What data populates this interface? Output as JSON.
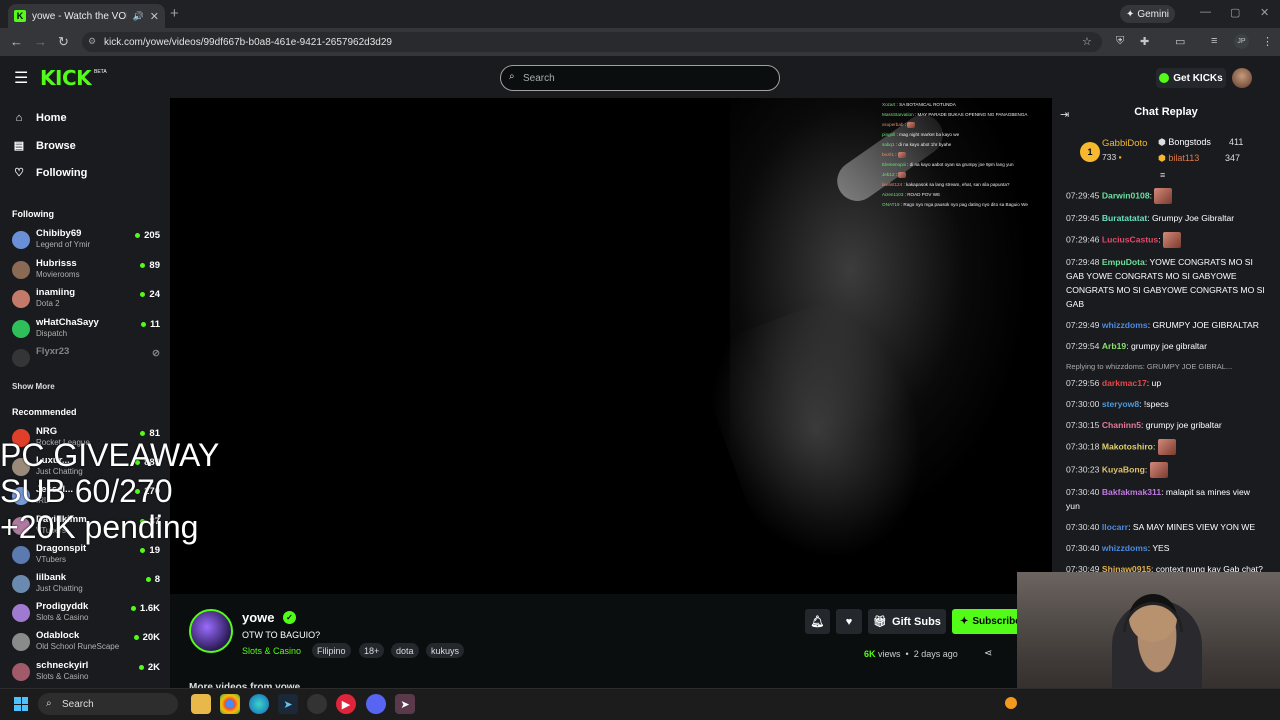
{
  "browser": {
    "tab_title": "yowe - Watch the VOD on Kick",
    "tab_favicon": "K",
    "new_tab": "+",
    "url": "kick.com/yowe/videos/99df667b-b0a8-461e-9421-2657962d3d29",
    "gemini_label": "Gemini",
    "profile_initials": "JP"
  },
  "header": {
    "logo": "KICK",
    "logo_badge": "BETA",
    "search_placeholder": "Search",
    "get_kicks": "Get KICKs"
  },
  "sidebar": {
    "nav": [
      {
        "label": "Home",
        "icon": "home-icon"
      },
      {
        "label": "Browse",
        "icon": "browse-icon"
      },
      {
        "label": "Following",
        "icon": "heart-icon"
      }
    ],
    "following_title": "Following",
    "following": [
      {
        "name": "Chibiby69",
        "category": "Legend of Ymir",
        "count": "205",
        "color": "#6b8fd6"
      },
      {
        "name": "Hubrisss",
        "category": "Movierooms",
        "count": "89",
        "color": "#8a6a55"
      },
      {
        "name": "inamiing",
        "category": "Dota 2",
        "count": "24",
        "color": "#c47a6a"
      },
      {
        "name": "wHatChaSayy",
        "category": "Dispatch",
        "count": "11",
        "color": "#2fbf5a"
      },
      {
        "name": "Flyxr23",
        "category": "",
        "count": "",
        "color": "#555"
      }
    ],
    "show_more": "Show More",
    "recommended_title": "Recommended",
    "recommended": [
      {
        "name": "NRG",
        "category": "Rocket League",
        "count": "81",
        "color": "#e0402a"
      },
      {
        "name": "Luxur...",
        "category": "Just Chatting",
        "count": "889",
        "color": "#9a8a7a"
      },
      {
        "name": "Jessel...",
        "category": "IRL",
        "count": "270",
        "color": "#7a9ad6"
      },
      {
        "name": "Davidkimm_",
        "category": "VTubers",
        "count": "87",
        "color": "#b07aa0"
      },
      {
        "name": "Dragonspit",
        "category": "VTubers",
        "count": "19",
        "color": "#5a7ab0"
      },
      {
        "name": "lilbank",
        "category": "Just Chatting",
        "count": "8",
        "color": "#6a8ab0"
      },
      {
        "name": "Prodigyddk",
        "category": "Slots & Casino",
        "count": "1.6K",
        "color": "#a07ad0"
      },
      {
        "name": "Odablock",
        "category": "Old School RuneScape",
        "count": "20K",
        "color": "#8a8a8a"
      },
      {
        "name": "schneckyirl",
        "category": "Slots & Casino",
        "count": "2K",
        "color": "#a05a6a"
      }
    ]
  },
  "overlay": {
    "line1": "PC GIVEAWAY",
    "line2": "SUB 60/270",
    "line3": "+20K pending"
  },
  "video_chat": [
    {
      "user": "Xozart",
      "text": "SA BOTANICAL ROTUNDA"
    },
    {
      "user": "MassStarvation",
      "text": "MAY PARADE BUKAS OPENING NG PANAGBENGA"
    },
    {
      "user": "xsuperbab",
      "text": ""
    },
    {
      "user": "pingoll",
      "text": "mag night market ba kayo we"
    },
    {
      "user": "sabq1",
      "text": "di na kayo abot 1hr byahe"
    },
    {
      "user": "bezil1",
      "text": ""
    },
    {
      "user": "Elemenopiii",
      "text": "di na kayo aabot oyan sa grumpy joe 9pm lang yun"
    },
    {
      "user": "Jeb12",
      "text": ""
    },
    {
      "user": "lawlist124",
      "text": "kakapasok sa lang stream, ehat, san sila papunta?"
    },
    {
      "user": "Aizen1103",
      "text": "ROAD POV WE"
    },
    {
      "user": "ONAT19",
      "text": "Rago nyo mga pausok nyo pag dating nyo dito sa Baguio We"
    }
  ],
  "stream": {
    "channel": "yowe",
    "title": "OTW TO BAGUIO?",
    "category": "Slots & Casino",
    "tags": [
      "Filipino",
      "18+",
      "dota",
      "kukuys"
    ],
    "gift_subs": "Gift Subs",
    "subscribe": "Subscribe",
    "views_count": "6K",
    "views_label": "views",
    "age": "2 days ago",
    "more_videos": "More videos from yowe"
  },
  "chat": {
    "title": "Chat Replay",
    "leaders": [
      {
        "rank": "1",
        "name": "GabbiDoto",
        "value": "733"
      },
      {
        "name": "Bongstods",
        "value": "411"
      },
      {
        "name": "bilat113",
        "value": "347"
      }
    ],
    "messages": [
      {
        "time": "07:29:45",
        "user": "Darwin0108",
        "text": "",
        "color": "#6ae0a0",
        "emote": true
      },
      {
        "time": "07:29:45",
        "user": "Buratatatat",
        "text": "Grumpy Joe Gibraltar",
        "color": "#6ae0c0"
      },
      {
        "time": "07:29:46",
        "user": "LuciusCastus",
        "text": "",
        "color": "#e04a6a",
        "emote": true
      },
      {
        "time": "07:29:48",
        "user": "EmpuDota",
        "text": "YOWE CONGRATS MO SI GAB YOWE CONGRATS MO SI GABYOWE CONGRATS MO SI GABYOWE CONGRATS MO SI GAB",
        "color": "#6ae09a"
      },
      {
        "time": "07:29:49",
        "user": "whizzdoms",
        "text": "GRUMPY JOE GIBRALTAR",
        "color": "#4a8ae0"
      },
      {
        "time": "07:29:54",
        "user": "Arb19",
        "text": "grumpy joe gibraltar",
        "color": "#8ae06a"
      },
      {
        "time": "07:29:56",
        "user": "darkmac17",
        "text": "up",
        "color": "#e04a4a",
        "reply": "Replying to whizzdoms: GRUMPY JOE GIBRAL..."
      },
      {
        "time": "07:30:00",
        "user": "steryow8",
        "text": "!specs",
        "color": "#4a9ae0"
      },
      {
        "time": "07:30:15",
        "user": "Chaninn5",
        "text": "grumpy joe gribaltar",
        "color": "#e07a9a"
      },
      {
        "time": "07:30:18",
        "user": "Makotoshiro",
        "text": "",
        "color": "#e0d06a",
        "emote": true
      },
      {
        "time": "07:30:23",
        "user": "KuyaBong",
        "text": "",
        "color": "#e0c06a",
        "emote": true
      },
      {
        "time": "07:30:40",
        "user": "Bakfakmak311",
        "text": "malapit sa mines view yun",
        "color": "#c07ae0"
      },
      {
        "time": "07:30:40",
        "user": "llocarr",
        "text": "SA MAY MINES VIEW YON WE",
        "color": "#4a8ae0"
      },
      {
        "time": "07:30:40",
        "user": "whizzdoms",
        "text": "YES",
        "color": "#4a8ae0"
      },
      {
        "time": "07:30:49",
        "user": "Shinaw0915",
        "text": "context nung kay Gab chat?",
        "color": "#e0b04a"
      }
    ]
  },
  "taskbar": {
    "search_label": "Search"
  },
  "colors": {
    "accent": "#53fc18",
    "bg": "#0b0e0f",
    "panel": "#191b1f"
  }
}
